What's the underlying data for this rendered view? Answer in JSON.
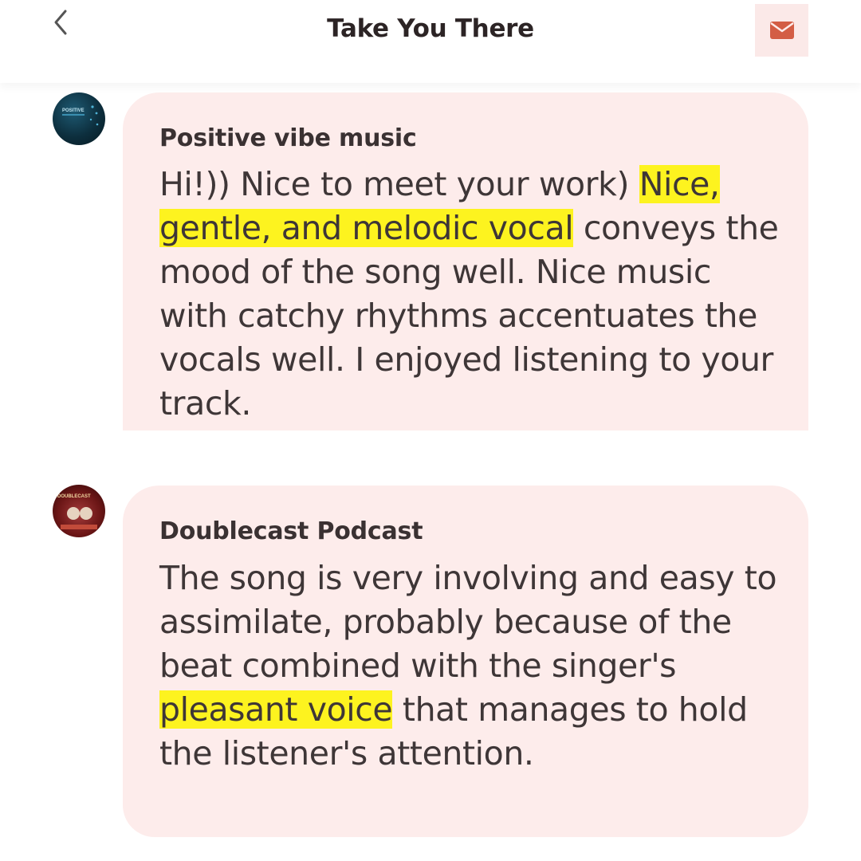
{
  "header": {
    "title": "Take You There",
    "back_icon": "chevron-left-icon",
    "mail_icon": "envelope-icon",
    "accent_color": "#d35d45"
  },
  "comments": [
    {
      "author": "Positive vibe music",
      "avatar_text": "POSITIVE",
      "text_before": "Hi!)) Nice to meet your work) ",
      "highlight": "Nice, gentle, and melodic vocal",
      "text_after": " conveys the mood of the song well. Nice music with catchy rhythms accentuates the vocals well. I enjoyed listening to your track."
    },
    {
      "author": "Doublecast Podcast",
      "avatar_text": "DOUBLECAST",
      "text_before": "The song is very involving and easy to assimilate, probably because of the beat combined with the singer's ",
      "highlight": "pleasant voice",
      "text_after": " that manages to hold the listener's attention."
    }
  ],
  "colors": {
    "bubble_bg": "#fdeceb",
    "highlight": "#fdf31f"
  }
}
